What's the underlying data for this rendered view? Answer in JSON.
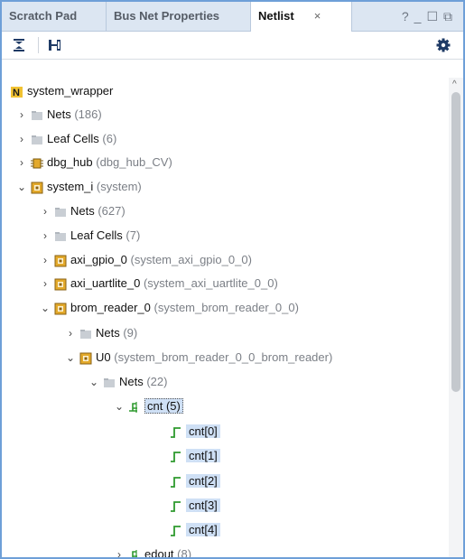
{
  "tabs": [
    {
      "label": "Scratch Pad"
    },
    {
      "label": "Bus Net Properties"
    },
    {
      "label": "Netlist",
      "close": "×"
    }
  ],
  "window_controls": {
    "help": "?",
    "minimize": "_",
    "maximize": "☐",
    "restore": "⧉"
  },
  "toolbar": {
    "collapse_all_icon": "collapse-all-icon",
    "expand_icon": "hierarchy-icon",
    "settings_icon": "gear-icon"
  },
  "tree": [
    {
      "name": "system_wrapper",
      "sub": "",
      "icon": "netlist-root-icon",
      "chev": ""
    },
    {
      "name": "Nets",
      "sub": "(186)",
      "icon": "folder-icon",
      "chev": "›"
    },
    {
      "name": "Leaf Cells",
      "sub": "(6)",
      "icon": "folder-icon",
      "chev": "›"
    },
    {
      "name": "dbg_hub",
      "sub": "(dbg_hub_CV)",
      "icon": "debug-core-icon",
      "chev": "›"
    },
    {
      "name": "system_i",
      "sub": "(system)",
      "icon": "cell-icon",
      "chev": "⌄"
    },
    {
      "name": "Nets",
      "sub": "(627)",
      "icon": "folder-icon",
      "chev": "›"
    },
    {
      "name": "Leaf Cells",
      "sub": "(7)",
      "icon": "folder-icon",
      "chev": "›"
    },
    {
      "name": "axi_gpio_0",
      "sub": "(system_axi_gpio_0_0)",
      "icon": "cell-icon",
      "chev": "›"
    },
    {
      "name": "axi_uartlite_0",
      "sub": "(system_axi_uartlite_0_0)",
      "icon": "cell-icon",
      "chev": "›"
    },
    {
      "name": "brom_reader_0",
      "sub": "(system_brom_reader_0_0)",
      "icon": "cell-icon",
      "chev": "⌄"
    },
    {
      "name": "Nets",
      "sub": "(9)",
      "icon": "folder-icon",
      "chev": "›"
    },
    {
      "name": "U0",
      "sub": "(system_brom_reader_0_0_brom_reader)",
      "icon": "cell-icon",
      "chev": "⌄"
    },
    {
      "name": "Nets",
      "sub": "(22)",
      "icon": "folder-icon",
      "chev": "⌄"
    },
    {
      "name": "cnt (5)",
      "sub": "",
      "icon": "bus-net-icon",
      "chev": "⌄"
    },
    {
      "name": "cnt[0]",
      "sub": "",
      "icon": "net-icon",
      "chev": ""
    },
    {
      "name": "cnt[1]",
      "sub": "",
      "icon": "net-icon",
      "chev": ""
    },
    {
      "name": "cnt[2]",
      "sub": "",
      "icon": "net-icon",
      "chev": ""
    },
    {
      "name": "cnt[3]",
      "sub": "",
      "icon": "net-icon",
      "chev": ""
    },
    {
      "name": "cnt[4]",
      "sub": "",
      "icon": "net-icon",
      "chev": ""
    },
    {
      "name": "edout",
      "sub": "(8)",
      "icon": "bus-net-icon",
      "chev": "›"
    }
  ],
  "colors": {
    "accent": "#6e9fd8",
    "selection": "#cfe0f5",
    "net_green": "#2e9a2e",
    "cell_orange": "#e3a92b"
  }
}
